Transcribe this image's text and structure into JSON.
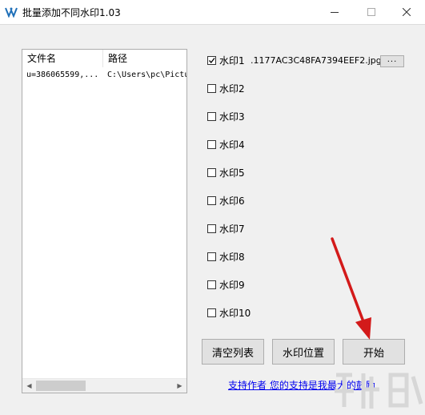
{
  "window": {
    "title": "批量添加不同水印1.03"
  },
  "file_table": {
    "columns": [
      "文件名",
      "路径"
    ],
    "rows": [
      [
        "u=386065599,...",
        "C:\\Users\\pc\\Pictu"
      ]
    ]
  },
  "watermarks": [
    {
      "label": "水印1",
      "checked": true,
      "file": ".1177AC3C48FA7394EEF2.jpg"
    },
    {
      "label": "水印2",
      "checked": false
    },
    {
      "label": "水印3",
      "checked": false
    },
    {
      "label": "水印4",
      "checked": false
    },
    {
      "label": "水印5",
      "checked": false
    },
    {
      "label": "水印6",
      "checked": false
    },
    {
      "label": "水印7",
      "checked": false
    },
    {
      "label": "水印8",
      "checked": false
    },
    {
      "label": "水印9",
      "checked": false
    },
    {
      "label": "水印10",
      "checked": false
    }
  ],
  "browse_button": {
    "label": "..."
  },
  "buttons": {
    "clear": "清空列表",
    "position": "水印位置",
    "start": "开始"
  },
  "support_link": "支持作者  您的支持是我最大的鼓励",
  "colors": {
    "link": "#0000ee",
    "arrow": "#d31a1a"
  }
}
